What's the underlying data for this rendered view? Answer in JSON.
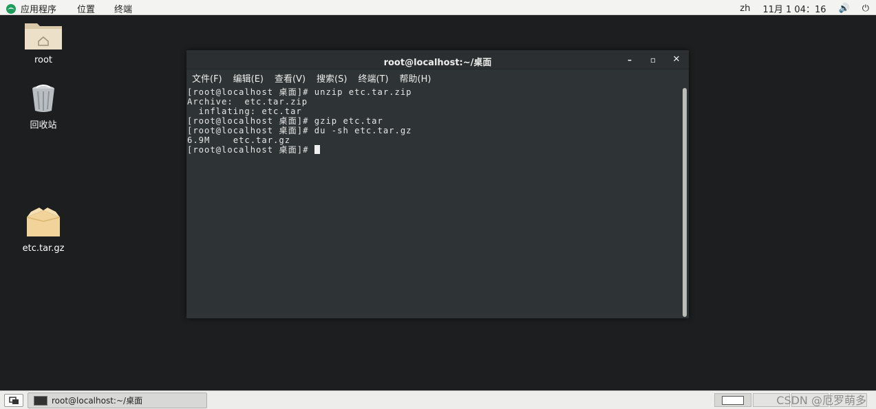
{
  "topbar": {
    "apps": "应用程序",
    "places": "位置",
    "terminal": "终端",
    "lang": "zh",
    "datetime": "11月 1 04：16"
  },
  "desktop": {
    "icons": [
      {
        "label": "root"
      },
      {
        "label": "回收站"
      },
      {
        "label": "etc.tar.gz"
      }
    ]
  },
  "window": {
    "title": "root@localhost:~/桌面",
    "menu": [
      "文件(F)",
      "编辑(E)",
      "查看(V)",
      "搜索(S)",
      "终端(T)",
      "帮助(H)"
    ],
    "lines": [
      "[root@localhost 桌面]# unzip etc.tar.zip",
      "Archive:  etc.tar.zip",
      "  inflating: etc.tar",
      "[root@localhost 桌面]# gzip etc.tar",
      "[root@localhost 桌面]# du -sh etc.tar.gz",
      "6.9M    etc.tar.gz",
      "[root@localhost 桌面]# "
    ]
  },
  "taskbar": {
    "task_label": "root@localhost:~/桌面"
  },
  "watermark": "CSDN @厄罗萌多",
  "colors": {
    "desktop_bg": "#1c1e20",
    "terminal_bg": "#2e3436",
    "topbar_bg": "#f3f3f2"
  }
}
